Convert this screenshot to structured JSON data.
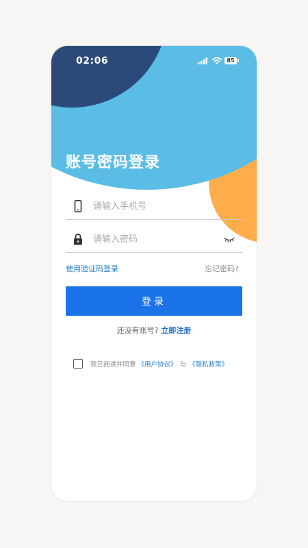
{
  "status_bar": {
    "time": "02:06",
    "battery": "85",
    "signal_icon": "cellular-signal-icon",
    "wifi_icon": "wifi-icon"
  },
  "colors": {
    "header_light_blue": "#5bbde6",
    "header_dark_blue": "#2b4a7a",
    "accent_orange": "#ffad4a",
    "primary_blue": "#1a73e8",
    "link_blue": "#2b82c9"
  },
  "header": {
    "title": "账号密码登录"
  },
  "form": {
    "phone": {
      "icon": "mobile-phone-icon",
      "placeholder": "请输入手机号",
      "value": ""
    },
    "password": {
      "icon": "lock-icon",
      "placeholder": "请输入密码",
      "value": "",
      "toggle_icon": "eye-closed-icon"
    },
    "sms_login_link": "使用验证码登录",
    "forgot_password_link": "忘记密码?",
    "login_button": "登录"
  },
  "register": {
    "prompt": "还没有账号?",
    "link": "立即注册"
  },
  "agreement": {
    "checked": false,
    "prefix": "我已阅读并同意",
    "user_agreement": "《用户协议》",
    "separator": "与",
    "privacy_policy": "《隐私政策》"
  }
}
